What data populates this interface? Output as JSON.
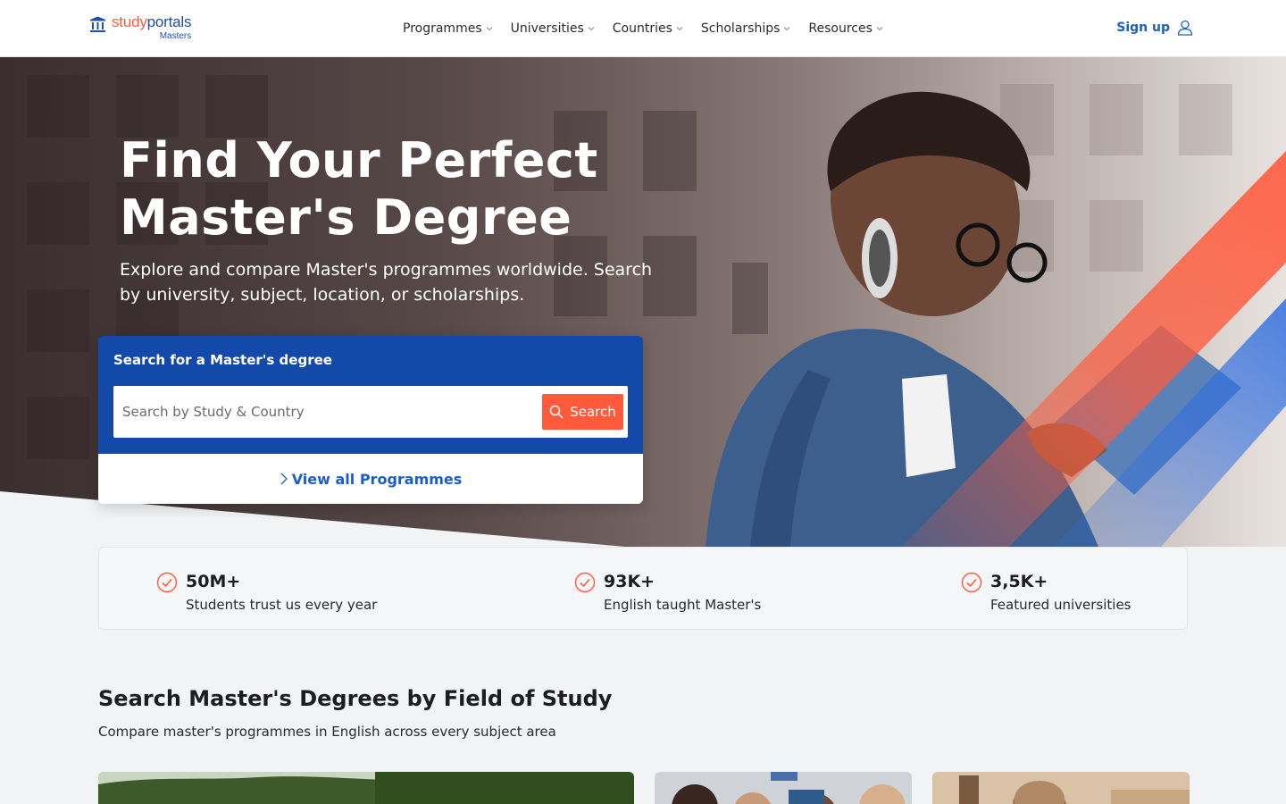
{
  "brand": {
    "name_part1": "study",
    "name_part2": "portals",
    "product": "Masters",
    "logo_icon": "university-columns-icon"
  },
  "nav": {
    "items": [
      {
        "label": "Programmes",
        "icon": "chevron-down-icon"
      },
      {
        "label": "Universities",
        "icon": "chevron-down-icon"
      },
      {
        "label": "Countries",
        "icon": "chevron-down-icon"
      },
      {
        "label": "Scholarships",
        "icon": "chevron-down-icon"
      },
      {
        "label": "Resources",
        "icon": "chevron-down-icon"
      }
    ],
    "signup_label": "Sign up",
    "signup_icon": "user-icon"
  },
  "hero": {
    "title": "Find Your Perfect Master's Degree",
    "subtitle": "Explore and compare Master's programmes worldwide. Search by university, subject, location, or scholarships."
  },
  "search": {
    "label": "Search for a Master's degree",
    "placeholder": "Search by Study & Country",
    "value": "",
    "button_label": "Search",
    "button_icon": "search-icon",
    "view_all_label": "View all Programmes",
    "view_all_icon": "chevron-right-icon"
  },
  "stats": [
    {
      "value": "50M+",
      "label": "Students trust us every year",
      "icon": "check-circle-icon"
    },
    {
      "value": "93K+",
      "label": "English taught Master's",
      "icon": "check-circle-icon"
    },
    {
      "value": "3,5K+",
      "label": "Featured universities",
      "icon": "check-circle-icon"
    }
  ],
  "fields": {
    "title": "Search Master's Degrees by Field of Study",
    "subtitle": "Compare master's programmes in English across every subject area"
  },
  "colors": {
    "brand_blue": "#1349a8",
    "link_blue": "#1a5fc7",
    "accent_orange": "#ff5a3c"
  }
}
